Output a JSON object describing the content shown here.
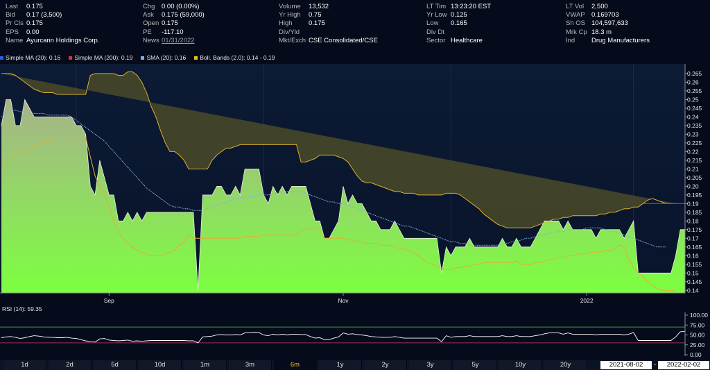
{
  "quote": {
    "columns": [
      [
        {
          "k": "Last",
          "v": "0.175"
        },
        {
          "k": "Bid",
          "v": "0.17 (3,500)"
        },
        {
          "k": "Pr Cls",
          "v": "0.175"
        },
        {
          "k": "EPS",
          "v": "0.00"
        },
        {
          "k": "Name",
          "v": "Ayurcann Holdings Corp."
        }
      ],
      [
        {
          "k": "Chg",
          "v": "0.00 (0.00%)"
        },
        {
          "k": "Ask",
          "v": "0.175 (59,000)"
        },
        {
          "k": "Open",
          "v": "0.175"
        },
        {
          "k": "PE",
          "v": "-117.10"
        },
        {
          "k": "News",
          "v": "01/31/2022"
        }
      ],
      [
        {
          "k": "Volume",
          "v": "13,532"
        },
        {
          "k": "Yr High",
          "v": "0.75"
        },
        {
          "k": "High",
          "v": "0.175"
        },
        {
          "k": "Div/Yld",
          "v": ""
        },
        {
          "k": "Mkt/Exch",
          "v": "CSE Consolidated/CSE"
        }
      ],
      [
        {
          "k": "LT Tim",
          "v": "13:23:20 EST"
        },
        {
          "k": "Yr Low",
          "v": "0.125"
        },
        {
          "k": "Low",
          "v": "0.165"
        },
        {
          "k": "Div Dt",
          "v": ""
        },
        {
          "k": "Sector",
          "v": "Healthcare"
        }
      ],
      [
        {
          "k": "LT Vol",
          "v": "2,500"
        },
        {
          "k": "VWAP",
          "v": "0.169703"
        },
        {
          "k": "Sh OS",
          "v": "104,597,633"
        },
        {
          "k": "Mrk Cp",
          "v": "18.3 m"
        },
        {
          "k": "Ind",
          "v": "Drug Manufacturers"
        }
      ]
    ]
  },
  "legend": [
    {
      "label": "Simple MA (20): 0.16",
      "color": "#2f5fe0"
    },
    {
      "label": "Simple MA (200): 0.19",
      "color": "#e03030"
    },
    {
      "label": "SMA (20): 0.16",
      "color": "#7fb0e8"
    },
    {
      "label": "Boll. Bands (2.0): 0.14 - 0.19",
      "color": "#e0c020"
    }
  ],
  "rsi_label": "RSI (14): 59.35",
  "ranges": [
    {
      "label": "1d",
      "active": false
    },
    {
      "label": "2d",
      "active": false
    },
    {
      "label": "5d",
      "active": false
    },
    {
      "label": "10d",
      "active": false
    },
    {
      "label": "1m",
      "active": false
    },
    {
      "label": "3m",
      "active": false
    },
    {
      "label": "6m",
      "active": true
    },
    {
      "label": "1y",
      "active": false
    },
    {
      "label": "2y",
      "active": false
    },
    {
      "label": "3y",
      "active": false
    },
    {
      "label": "5y",
      "active": false
    },
    {
      "label": "10y",
      "active": false
    },
    {
      "label": "20y",
      "active": false
    }
  ],
  "date_from": "2021-08-02",
  "date_sep": "-",
  "date_to": "2022-02-02",
  "colors": {
    "background": "#050b1a",
    "price_fill_top": "#a8b28a",
    "price_fill_bottom": "#7cff40",
    "band_fill": "#4a4a28",
    "upper_band": "#e0b030",
    "lower_band": "#e0b030",
    "sma": "#7fb0e8",
    "ma200": "#e03030",
    "rsi_line": "#ffffff",
    "rsi_upper": "#2e9e4a",
    "rsi_lower": "#9e2e5a",
    "active_range": "#f2c21a"
  },
  "chart_data": [
    {
      "type": "area",
      "series_name": "Price",
      "x_tick_labels": [
        "Sep",
        "Nov",
        "2022"
      ],
      "x_tick_index": [
        23,
        73,
        125
      ],
      "y_ticks": [
        0.14,
        0.145,
        0.15,
        0.155,
        0.16,
        0.165,
        0.17,
        0.175,
        0.18,
        0.185,
        0.19,
        0.195,
        0.2,
        0.205,
        0.21,
        0.215,
        0.22,
        0.225,
        0.23,
        0.235,
        0.24,
        0.245,
        0.25,
        0.255,
        0.26,
        0.265
      ],
      "y_range": [
        0.1385,
        0.2682
      ],
      "price": [
        0.235,
        0.25,
        0.25,
        0.235,
        0.235,
        0.25,
        0.245,
        0.24,
        0.24,
        0.24,
        0.24,
        0.24,
        0.24,
        0.24,
        0.24,
        0.24,
        0.235,
        0.235,
        0.23,
        0.2,
        0.195,
        0.215,
        0.205,
        0.195,
        0.195,
        0.18,
        0.18,
        0.185,
        0.18,
        0.185,
        0.18,
        0.185,
        0.185,
        0.185,
        0.185,
        0.185,
        0.185,
        0.185,
        0.185,
        0.185,
        0.185,
        0.185,
        0.14,
        0.195,
        0.195,
        0.195,
        0.2,
        0.2,
        0.195,
        0.195,
        0.2,
        0.195,
        0.21,
        0.21,
        0.21,
        0.21,
        0.195,
        0.19,
        0.2,
        0.195,
        0.2,
        0.195,
        0.2,
        0.2,
        0.2,
        0.2,
        0.19,
        0.18,
        0.18,
        0.17,
        0.17,
        0.175,
        0.18,
        0.2,
        0.19,
        0.195,
        0.19,
        0.19,
        0.185,
        0.18,
        0.18,
        0.175,
        0.175,
        0.175,
        0.18,
        0.175,
        0.17,
        0.17,
        0.17,
        0.17,
        0.17,
        0.17,
        0.17,
        0.17,
        0.15,
        0.165,
        0.16,
        0.165,
        0.165,
        0.165,
        0.17,
        0.165,
        0.165,
        0.165,
        0.165,
        0.165,
        0.165,
        0.17,
        0.165,
        0.165,
        0.17,
        0.165,
        0.165,
        0.165,
        0.17,
        0.175,
        0.18,
        0.18,
        0.18,
        0.18,
        0.175,
        0.18,
        0.175,
        0.175,
        0.175,
        0.175,
        0.175,
        0.17,
        0.175,
        0.175,
        0.175,
        0.175,
        0.175,
        0.17,
        0.175,
        0.18,
        0.15,
        0.15,
        0.15,
        0.15,
        0.15,
        0.15,
        0.15,
        0.15,
        0.16,
        0.175,
        0.175
      ],
      "upper_band": [
        0.265,
        0.265,
        0.265,
        0.264,
        0.262,
        0.26,
        0.258,
        0.256,
        0.255,
        0.254,
        0.254,
        0.254,
        0.253,
        0.253,
        0.253,
        0.253,
        0.253,
        0.253,
        0.253,
        0.264,
        0.265,
        0.265,
        0.265,
        0.265,
        0.265,
        0.264,
        0.264,
        0.266,
        0.266,
        0.264,
        0.26,
        0.254,
        0.246,
        0.24,
        0.232,
        0.225,
        0.22,
        0.22,
        0.218,
        0.215,
        0.21,
        0.21,
        0.21,
        0.21,
        0.21,
        0.215,
        0.218,
        0.22,
        0.222,
        0.222,
        0.223,
        0.224,
        0.224,
        0.224,
        0.224,
        0.224,
        0.224,
        0.224,
        0.224,
        0.224,
        0.224,
        0.224,
        0.224,
        0.224,
        0.214,
        0.214,
        0.215,
        0.216,
        0.218,
        0.218,
        0.218,
        0.218,
        0.217,
        0.216,
        0.214,
        0.21,
        0.206,
        0.203,
        0.202,
        0.202,
        0.201,
        0.2,
        0.199,
        0.198,
        0.197,
        0.197,
        0.196,
        0.196,
        0.196,
        0.195,
        0.195,
        0.195,
        0.195,
        0.195,
        0.195,
        0.196,
        0.196,
        0.196,
        0.195,
        0.193,
        0.191,
        0.189,
        0.187,
        0.184,
        0.182,
        0.18,
        0.178,
        0.177,
        0.176,
        0.176,
        0.176,
        0.176,
        0.176,
        0.176,
        0.177,
        0.178,
        0.179,
        0.18,
        0.181,
        0.181,
        0.182,
        0.182,
        0.183,
        0.183,
        0.183,
        0.183,
        0.183,
        0.183,
        0.184,
        0.184,
        0.185,
        0.185,
        0.186,
        0.187,
        0.187,
        0.188,
        0.188,
        0.19,
        0.192,
        0.193,
        0.192,
        0.191,
        0.19,
        0.19,
        0.19
      ],
      "lower_band": [
        0.21,
        0.215,
        0.218,
        0.219,
        0.219,
        0.22,
        0.222,
        0.223,
        0.224,
        0.225,
        0.226,
        0.227,
        0.227,
        0.227,
        0.227,
        0.228,
        0.228,
        0.228,
        0.228,
        0.217,
        0.206,
        0.2,
        0.195,
        0.188,
        0.18,
        0.174,
        0.17,
        0.167,
        0.165,
        0.163,
        0.162,
        0.161,
        0.16,
        0.16,
        0.16,
        0.161,
        0.162,
        0.163,
        0.166,
        0.168,
        0.172,
        0.17,
        0.17,
        0.17,
        0.17,
        0.17,
        0.17,
        0.17,
        0.17,
        0.17,
        0.17,
        0.17,
        0.171,
        0.171,
        0.171,
        0.171,
        0.172,
        0.172,
        0.172,
        0.172,
        0.172,
        0.172,
        0.172,
        0.172,
        0.174,
        0.175,
        0.176,
        0.176,
        0.175,
        0.17,
        0.17,
        0.17,
        0.17,
        0.17,
        0.169,
        0.169,
        0.168,
        0.168,
        0.167,
        0.167,
        0.167,
        0.166,
        0.166,
        0.166,
        0.165,
        0.164,
        0.164,
        0.163,
        0.162,
        0.16,
        0.158,
        0.156,
        0.155,
        0.154,
        0.153,
        0.152,
        0.152,
        0.153,
        0.153,
        0.154,
        0.154,
        0.155,
        0.155,
        0.156,
        0.156,
        0.156,
        0.156,
        0.156,
        0.156,
        0.156,
        0.157,
        0.155,
        0.155,
        0.155,
        0.156,
        0.156,
        0.157,
        0.158,
        0.158,
        0.159,
        0.159,
        0.16,
        0.16,
        0.161,
        0.161,
        0.161,
        0.162,
        0.162,
        0.162,
        0.163,
        0.163,
        0.164,
        0.166,
        0.165,
        0.158,
        0.153,
        0.15,
        0.148,
        0.145,
        0.143,
        0.141,
        0.14,
        0.14,
        0.14,
        0.14
      ],
      "sma": [
        0.24,
        0.242,
        0.243,
        0.244,
        0.243,
        0.243,
        0.242,
        0.242,
        0.242,
        0.242,
        0.241,
        0.241,
        0.241,
        0.241,
        0.241,
        0.24,
        0.238,
        0.236,
        0.234,
        0.232,
        0.23,
        0.228,
        0.226,
        0.223,
        0.22,
        0.217,
        0.214,
        0.211,
        0.208,
        0.205,
        0.202,
        0.199,
        0.197,
        0.195,
        0.193,
        0.191,
        0.189,
        0.188,
        0.188,
        0.187,
        0.187,
        0.186,
        0.186,
        0.186,
        0.187,
        0.188,
        0.189,
        0.19,
        0.191,
        0.192,
        0.193,
        0.193,
        0.194,
        0.194,
        0.194,
        0.195,
        0.195,
        0.195,
        0.196,
        0.196,
        0.197,
        0.197,
        0.197,
        0.197,
        0.197,
        0.196,
        0.195,
        0.194,
        0.193,
        0.192,
        0.191,
        0.191,
        0.19,
        0.19,
        0.189,
        0.188,
        0.187,
        0.186,
        0.185,
        0.184,
        0.183,
        0.182,
        0.181,
        0.18,
        0.179,
        0.178,
        0.177,
        0.177,
        0.176,
        0.175,
        0.174,
        0.173,
        0.172,
        0.171,
        0.17,
        0.169,
        0.168,
        0.168,
        0.167,
        0.167,
        0.166,
        0.166,
        0.166,
        0.166,
        0.166,
        0.166,
        0.166,
        0.167,
        0.167,
        0.168,
        0.168,
        0.169,
        0.17,
        0.17,
        0.171,
        0.172,
        0.172,
        0.173,
        0.173,
        0.174,
        0.174,
        0.175,
        0.175,
        0.175,
        0.175,
        0.176,
        0.176,
        0.176,
        0.176,
        0.175,
        0.174,
        0.174,
        0.173,
        0.172,
        0.171,
        0.17,
        0.169,
        0.168,
        0.167,
        0.166,
        0.165,
        0.165,
        0.165
      ],
      "ma200_tail": [
        0.19,
        0.19,
        0.19,
        0.19,
        0.19,
        0.19,
        0.19,
        0.19,
        0.19,
        0.19
      ]
    },
    {
      "type": "line",
      "series_name": "RSI (14)",
      "y_ticks": [
        0,
        25,
        50,
        75,
        100
      ],
      "y_tick_labels": [
        "0.00",
        "25.00",
        "50.00",
        "75.00",
        "100.00"
      ],
      "y_range": [
        0,
        100
      ],
      "overbought": 70,
      "oversold": 30,
      "values": [
        43,
        45,
        46,
        44,
        41,
        43,
        46,
        48,
        47,
        45,
        44,
        44,
        43,
        43,
        44,
        42,
        41,
        38,
        35,
        33,
        32,
        40,
        41,
        37,
        36,
        35,
        36,
        37,
        34,
        35,
        34,
        35,
        36,
        36,
        36,
        36,
        36,
        36,
        36,
        36,
        35,
        35,
        30,
        45,
        46,
        47,
        50,
        51,
        50,
        50,
        51,
        50,
        55,
        56,
        57,
        56,
        50,
        48,
        52,
        50,
        52,
        50,
        52,
        52,
        51,
        51,
        46,
        42,
        43,
        38,
        38,
        42,
        45,
        55,
        52,
        53,
        51,
        50,
        48,
        46,
        45,
        44,
        44,
        44,
        46,
        44,
        42,
        42,
        42,
        42,
        42,
        42,
        42,
        42,
        33,
        48,
        44,
        46,
        46,
        46,
        48,
        46,
        46,
        46,
        46,
        46,
        46,
        48,
        46,
        46,
        48,
        46,
        46,
        46,
        48,
        50,
        53,
        55,
        55,
        55,
        52,
        55,
        52,
        52,
        52,
        52,
        52,
        50,
        52,
        52,
        52,
        52,
        52,
        50,
        52,
        56,
        36,
        36,
        36,
        36,
        36,
        36,
        36,
        36,
        45,
        58,
        59
      ]
    }
  ]
}
